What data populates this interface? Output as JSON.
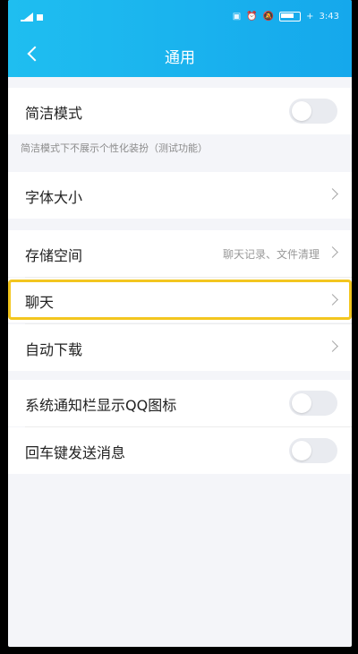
{
  "status": {
    "time": "3:43",
    "battery": "+"
  },
  "header": {
    "title": "通用"
  },
  "rows": {
    "simple_mode": {
      "label": "简洁模式"
    },
    "simple_note": "简洁模式下不展示个性化装扮（测试功能）",
    "font_size": {
      "label": "字体大小"
    },
    "storage": {
      "label": "存储空间",
      "hint": "聊天记录、文件清理"
    },
    "chat": {
      "label": "聊天"
    },
    "auto_download": {
      "label": "自动下载"
    },
    "qq_icon": {
      "label": "系统通知栏显示QQ图标"
    },
    "enter_send": {
      "label": "回车键发送消息"
    }
  }
}
